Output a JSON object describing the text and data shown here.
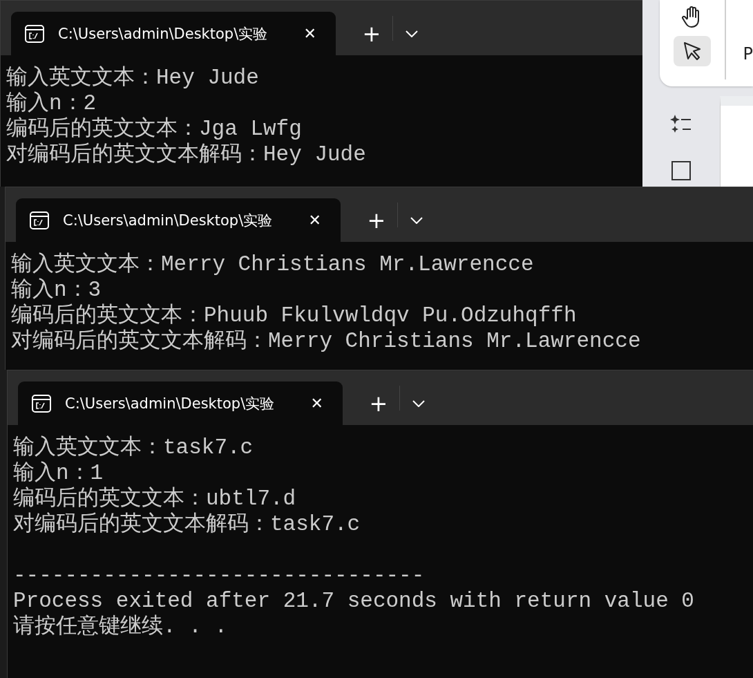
{
  "windows": [
    {
      "tab": {
        "title": "C:\\Users\\admin\\Desktop\\实验",
        "close": "✕",
        "new": "+"
      },
      "lines": [
        "输入英文文本：Hey Jude",
        "输入n：2",
        "编码后的英文文本：Jga Lwfg",
        "对编码后的英文文本解码：Hey Jude"
      ]
    },
    {
      "tab": {
        "title": "C:\\Users\\admin\\Desktop\\实验",
        "close": "✕",
        "new": "+"
      },
      "lines": [
        "输入英文文本：Merry Christians Mr.Lawrencce",
        "输入n：3",
        "编码后的英文文本：Phuub Fkulvwldqv Pu.Odzuhqffh",
        "对编码后的英文文本解码：Merry Christians Mr.Lawrencce"
      ]
    },
    {
      "tab": {
        "title": "C:\\Users\\admin\\Desktop\\实验",
        "close": "✕",
        "new": "+"
      },
      "lines": [
        "输入英文文本：task7.c",
        "输入n：1",
        "编码后的英文文本：ubtl7.d",
        "对编码后的英文文本解码：task7.c"
      ],
      "footer": [
        "--------------------------------",
        "Process exited after 21.7 seconds with return value 0",
        "请按任意键继续. . ."
      ]
    }
  ],
  "side_app": {
    "tools": [
      {
        "kind": "hand",
        "selected": false
      },
      {
        "kind": "pointer",
        "selected": true
      }
    ],
    "label": "P"
  }
}
